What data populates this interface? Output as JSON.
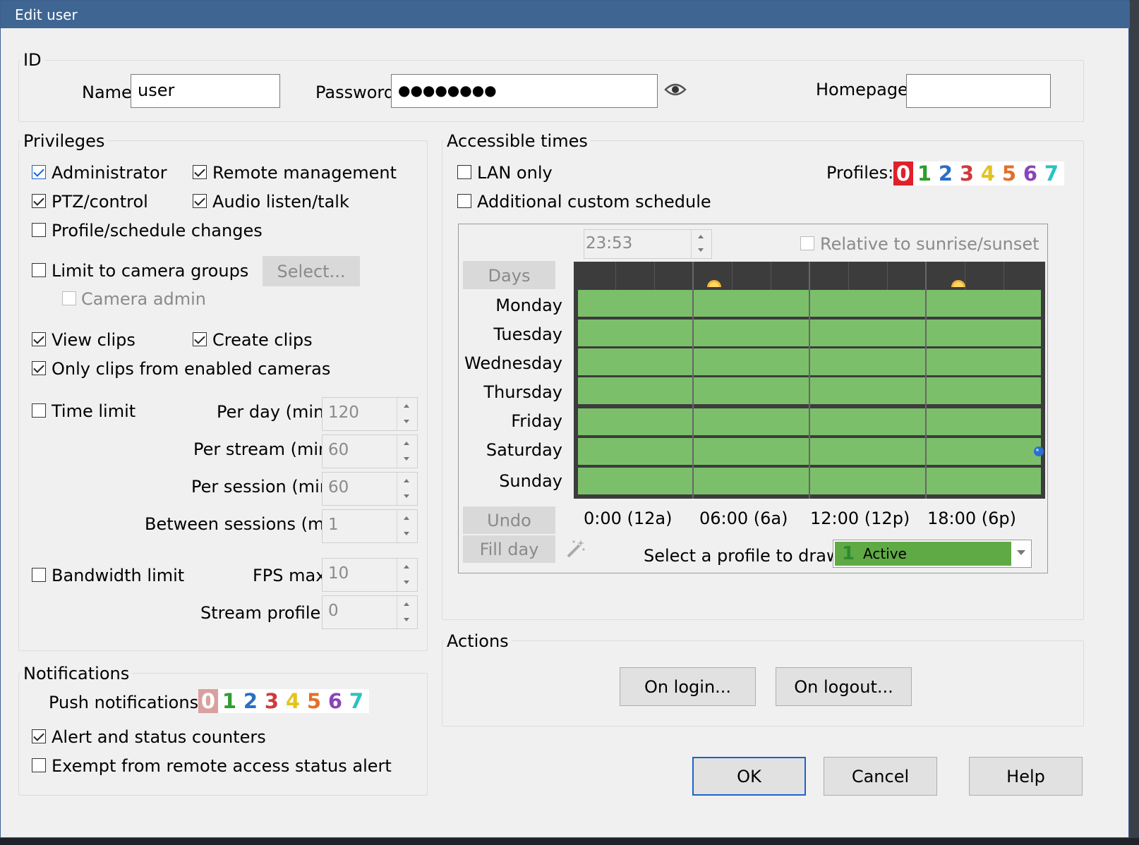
{
  "window": {
    "title": "Edit user"
  },
  "id_group": {
    "title": "ID",
    "name_label": "Name",
    "name_value": "user",
    "password_label": "Password",
    "password_value": "●●●●●●●●",
    "homepage_label": "Homepage",
    "homepage_value": ""
  },
  "privileges": {
    "title": "Privileges",
    "administrator": "Administrator",
    "remote_management": "Remote management",
    "ptz_control": "PTZ/control",
    "audio": "Audio listen/talk",
    "profile_changes": "Profile/schedule changes",
    "limit_groups": "Limit to camera groups",
    "select_button": "Select...",
    "camera_admin": "Camera admin",
    "view_clips": "View clips",
    "create_clips": "Create clips",
    "only_enabled": "Only clips from enabled cameras",
    "time_limit": "Time limit",
    "per_day_label": "Per day (min):",
    "per_day_value": "120",
    "per_stream_label": "Per stream (min):",
    "per_stream_value": "60",
    "per_session_label": "Per session (min):",
    "per_session_value": "60",
    "between_label": "Between sessions (min):",
    "between_value": "1",
    "bandwidth_limit": "Bandwidth limit",
    "fps_label": "FPS max:",
    "fps_value": "10",
    "stream_profile_label": "Stream profile#:",
    "stream_profile_value": "0"
  },
  "notifications": {
    "title": "Notifications",
    "push_label": "Push notifications:",
    "digits": [
      "0",
      "1",
      "2",
      "3",
      "4",
      "5",
      "6",
      "7"
    ],
    "alert_counters": "Alert and status counters",
    "exempt": "Exempt from remote access status alert"
  },
  "accessible_times": {
    "title": "Accessible times",
    "lan_only": "LAN only",
    "custom_schedule": "Additional custom schedule",
    "profiles_label": "Profiles:",
    "profile_digits": [
      "0",
      "1",
      "2",
      "3",
      "4",
      "5",
      "6",
      "7"
    ],
    "time_value": "23:53",
    "relative_sun": "Relative to sunrise/sunset",
    "days_button": "Days",
    "days": [
      "Monday",
      "Tuesday",
      "Wednesday",
      "Thursday",
      "Friday",
      "Saturday",
      "Sunday"
    ],
    "undo_button": "Undo",
    "fill_day_button": "Fill day",
    "time_ticks": [
      "0:00 (12a)",
      "06:00 (6a)",
      "12:00 (12p)",
      "18:00 (6p)"
    ],
    "draw_profile_label": "Select a profile to draw:",
    "draw_profile_number": "1",
    "draw_profile_value": "Active"
  },
  "actions": {
    "title": "Actions",
    "on_login": "On login...",
    "on_logout": "On logout..."
  },
  "footer": {
    "ok": "OK",
    "cancel": "Cancel",
    "help": "Help"
  },
  "colors": {
    "title_bar": "#3f6592",
    "schedule_green": "#7cbf6b",
    "digit_colors": [
      "#e0202a",
      "#2e9e2e",
      "#2a6fc2",
      "#d13a3a",
      "#e2c420",
      "#e2702a",
      "#8a44b8",
      "#2ac2c2"
    ]
  }
}
